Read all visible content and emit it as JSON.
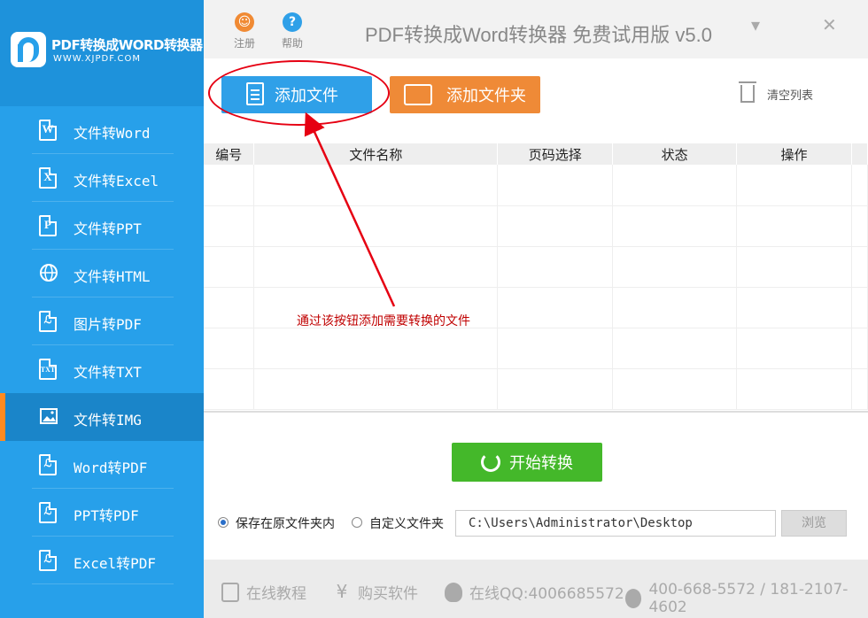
{
  "sidebar": {
    "logo_title": "PDF转换成WORD转换器",
    "logo_url": "WWW.XJPDF.COM",
    "items": [
      {
        "label": "文件转Word",
        "icon": "W"
      },
      {
        "label": "文件转Excel",
        "icon": "X"
      },
      {
        "label": "文件转PPT",
        "icon": "P"
      },
      {
        "label": "文件转HTML",
        "icon": "globe"
      },
      {
        "label": "图片转PDF",
        "icon": "pdf"
      },
      {
        "label": "文件转TXT",
        "icon": "TXT"
      },
      {
        "label": "文件转IMG",
        "icon": "image",
        "active": true
      },
      {
        "label": "Word转PDF",
        "icon": "pdf"
      },
      {
        "label": "PPT转PDF",
        "icon": "pdf"
      },
      {
        "label": "Excel转PDF",
        "icon": "pdf"
      }
    ]
  },
  "topbar": {
    "register_label": "注册",
    "help_label": "帮助",
    "title": "PDF转换成Word转换器 免费试用版 v5.0",
    "register_color": "#f08a34",
    "help_color": "#2fa0e8"
  },
  "toolbar": {
    "add_file_label": "添加文件",
    "add_folder_label": "添加文件夹",
    "clear_list_label": "清空列表"
  },
  "table": {
    "headers": [
      "编号",
      "文件名称",
      "页码选择",
      "状态",
      "操作"
    ],
    "rows": 6
  },
  "annotation": {
    "text": "通过该按钮添加需要转换的文件"
  },
  "actions": {
    "start_label": "开始转换"
  },
  "output": {
    "save_original_label": "保存在原文件夹内",
    "custom_folder_label": "自定义文件夹",
    "path_value": "C:\\Users\\Administrator\\Desktop",
    "browse_label": "浏览",
    "selected": "save_original"
  },
  "footer": {
    "tutorial_label": "在线教程",
    "buy_label": "购买软件",
    "qq_label": "在线QQ:4006685572",
    "phone_label": "400-668-5572 / 181-2107-4602"
  },
  "colors": {
    "sidebar_bg": "#27a0ea",
    "active_bg": "#1a85c9",
    "active_marker": "#ff8a1f",
    "add_file_bg": "#2fa0e8",
    "add_folder_bg": "#ef8a37",
    "start_bg": "#44b82a",
    "annotation_red": "#e60012"
  }
}
